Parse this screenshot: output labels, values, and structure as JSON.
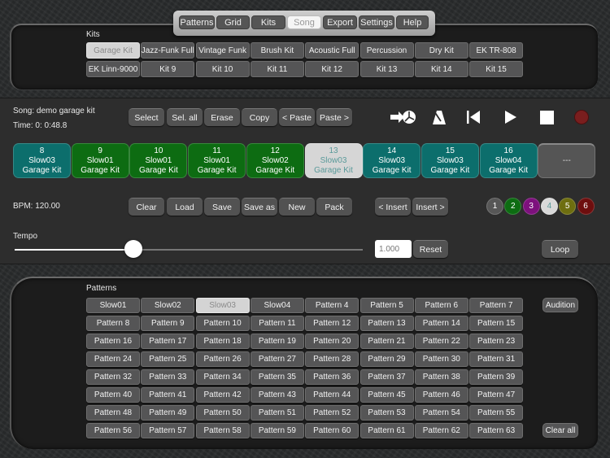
{
  "tabs": [
    {
      "label": "Patterns",
      "active": false
    },
    {
      "label": "Grid",
      "active": false
    },
    {
      "label": "Kits",
      "active": false
    },
    {
      "label": "Song",
      "active": true
    },
    {
      "label": "Export",
      "active": false
    },
    {
      "label": "Settings",
      "active": false
    },
    {
      "label": "Help",
      "active": false
    }
  ],
  "kits": {
    "label": "Kits",
    "selected": "Garage Kit",
    "items": [
      "Garage Kit",
      "Jazz-Funk Full",
      "Vintage Funk",
      "Brush Kit",
      "Acoustic Full",
      "Percussion",
      "Dry Kit",
      "EK TR-808",
      "EK Linn-9000",
      "Kit 9",
      "Kit 10",
      "Kit 11",
      "Kit 12",
      "Kit 13",
      "Kit 14",
      "Kit 15"
    ]
  },
  "song": {
    "name": "Song: demo garage kit",
    "time": "Time:  0: 0:48.8",
    "bpm": "BPM: 120.00",
    "edit_buttons": [
      "Select",
      "Sel. all",
      "Erase",
      "Copy",
      "< Paste",
      "Paste >"
    ],
    "file_buttons": [
      "Clear",
      "Load",
      "Save",
      "Save as",
      "New",
      "Pack"
    ],
    "insert_buttons": [
      "< Insert",
      "Insert >"
    ],
    "transport": [
      {
        "icon": "jump-to-time-icon"
      },
      {
        "icon": "metronome-icon"
      },
      {
        "icon": "skip-to-start-icon"
      },
      {
        "icon": "play-icon"
      },
      {
        "icon": "stop-icon"
      },
      {
        "icon": "record-icon",
        "color": "#7a1e1e"
      }
    ],
    "slots": [
      {
        "number": "8",
        "pattern": "Slow03",
        "kit": "Garage Kit",
        "color": "teal",
        "selected": false
      },
      {
        "number": "9",
        "pattern": "Slow01",
        "kit": "Garage Kit",
        "color": "green",
        "selected": false
      },
      {
        "number": "10",
        "pattern": "Slow01",
        "kit": "Garage Kit",
        "color": "green",
        "selected": false
      },
      {
        "number": "11",
        "pattern": "Slow01",
        "kit": "Garage Kit",
        "color": "green",
        "selected": false
      },
      {
        "number": "12",
        "pattern": "Slow02",
        "kit": "Garage Kit",
        "color": "green",
        "selected": false
      },
      {
        "number": "13",
        "pattern": "Slow03",
        "kit": "Garage Kit",
        "color": "teal",
        "selected": true
      },
      {
        "number": "14",
        "pattern": "Slow03",
        "kit": "Garage Kit",
        "color": "teal",
        "selected": false
      },
      {
        "number": "15",
        "pattern": "Slow03",
        "kit": "Garage Kit",
        "color": "teal",
        "selected": false
      },
      {
        "number": "16",
        "pattern": "Slow04",
        "kit": "Garage Kit",
        "color": "teal",
        "selected": false
      }
    ],
    "empty_slot_label": "---",
    "color_groups": [
      {
        "label": "1",
        "bg": "#575757",
        "fg": "#ffffff"
      },
      {
        "label": "2",
        "bg": "#0d6c12",
        "fg": "#ffffff"
      },
      {
        "label": "3",
        "bg": "#7d117d",
        "fg": "#ffffff"
      },
      {
        "label": "4",
        "bg": "#d9d9d9",
        "fg": "#5a9a9a"
      },
      {
        "label": "5",
        "bg": "#6e6e10",
        "fg": "#ffffff"
      },
      {
        "label": "6",
        "bg": "#6e0e0e",
        "fg": "#ffffff"
      }
    ]
  },
  "tempo": {
    "label": "Tempo",
    "value": "1.000",
    "slider_fraction": 0.34,
    "reset_label": "Reset",
    "loop_label": "Loop"
  },
  "patterns": {
    "label": "Patterns",
    "selected": "Slow03",
    "items": [
      "Slow01",
      "Slow02",
      "Slow03",
      "Slow04",
      "Pattern 4",
      "Pattern 5",
      "Pattern 6",
      "Pattern 7",
      "Pattern 8",
      "Pattern 9",
      "Pattern 10",
      "Pattern 11",
      "Pattern 12",
      "Pattern 13",
      "Pattern 14",
      "Pattern 15",
      "Pattern 16",
      "Pattern 17",
      "Pattern 18",
      "Pattern 19",
      "Pattern 20",
      "Pattern 21",
      "Pattern 22",
      "Pattern 23",
      "Pattern 24",
      "Pattern 25",
      "Pattern 26",
      "Pattern 27",
      "Pattern 28",
      "Pattern 29",
      "Pattern 30",
      "Pattern 31",
      "Pattern 32",
      "Pattern 33",
      "Pattern 34",
      "Pattern 35",
      "Pattern 36",
      "Pattern 37",
      "Pattern 38",
      "Pattern 39",
      "Pattern 40",
      "Pattern 41",
      "Pattern 42",
      "Pattern 43",
      "Pattern 44",
      "Pattern 45",
      "Pattern 46",
      "Pattern 47",
      "Pattern 48",
      "Pattern 49",
      "Pattern 50",
      "Pattern 51",
      "Pattern 52",
      "Pattern 53",
      "Pattern 54",
      "Pattern 55",
      "Pattern 56",
      "Pattern 57",
      "Pattern 58",
      "Pattern 59",
      "Pattern 60",
      "Pattern 61",
      "Pattern 62",
      "Pattern 63"
    ],
    "audition_label": "Audition",
    "clear_all_label": "Clear all"
  }
}
